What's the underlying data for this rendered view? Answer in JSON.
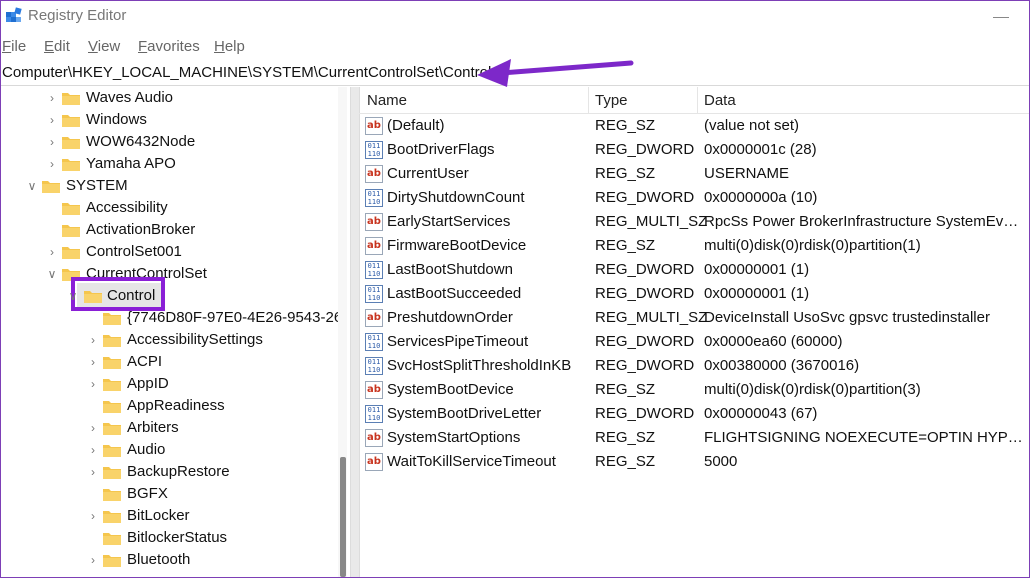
{
  "window": {
    "title": "Registry Editor"
  },
  "menu": [
    "File",
    "Edit",
    "View",
    "Favorites",
    "Help"
  ],
  "address": "Computer\\HKEY_LOCAL_MACHINE\\SYSTEM\\CurrentControlSet\\Control",
  "colors": {
    "highlight": "#8a1fd6",
    "arrow": "#7d28c9",
    "folder": "#f5c64d"
  },
  "tree": [
    {
      "label": "Waves Audio",
      "level": 2,
      "chevron": "collapsed"
    },
    {
      "label": "Windows",
      "level": 2,
      "chevron": "collapsed"
    },
    {
      "label": "WOW6432Node",
      "level": 2,
      "chevron": "collapsed"
    },
    {
      "label": "Yamaha APO",
      "level": 2,
      "chevron": "collapsed"
    },
    {
      "label": "SYSTEM",
      "level": 1,
      "chevron": "expanded"
    },
    {
      "label": "Accessibility",
      "level": 2,
      "chevron": "none"
    },
    {
      "label": "ActivationBroker",
      "level": 2,
      "chevron": "none"
    },
    {
      "label": "ControlSet001",
      "level": 2,
      "chevron": "collapsed"
    },
    {
      "label": "CurrentControlSet",
      "level": 2,
      "chevron": "expanded"
    },
    {
      "label": "Control",
      "level": 3,
      "chevron": "expanded",
      "selected": true
    },
    {
      "label": "{7746D80F-97E0-4E26-9543-26",
      "level": 4,
      "chevron": "none"
    },
    {
      "label": "AccessibilitySettings",
      "level": 4,
      "chevron": "collapsed"
    },
    {
      "label": "ACPI",
      "level": 4,
      "chevron": "collapsed"
    },
    {
      "label": "AppID",
      "level": 4,
      "chevron": "collapsed"
    },
    {
      "label": "AppReadiness",
      "level": 4,
      "chevron": "none"
    },
    {
      "label": "Arbiters",
      "level": 4,
      "chevron": "collapsed"
    },
    {
      "label": "Audio",
      "level": 4,
      "chevron": "collapsed"
    },
    {
      "label": "BackupRestore",
      "level": 4,
      "chevron": "collapsed"
    },
    {
      "label": "BGFX",
      "level": 4,
      "chevron": "none"
    },
    {
      "label": "BitLocker",
      "level": 4,
      "chevron": "collapsed"
    },
    {
      "label": "BitlockerStatus",
      "level": 4,
      "chevron": "none"
    },
    {
      "label": "Bluetooth",
      "level": 4,
      "chevron": "collapsed"
    }
  ],
  "columns": {
    "name": "Name",
    "type": "Type",
    "data": "Data"
  },
  "values": [
    {
      "icon": "string-value-icon",
      "name": "(Default)",
      "type": "REG_SZ",
      "data": "(value not set)"
    },
    {
      "icon": "binary-value-icon",
      "name": "BootDriverFlags",
      "type": "REG_DWORD",
      "data": "0x0000001c (28)"
    },
    {
      "icon": "string-value-icon",
      "name": "CurrentUser",
      "type": "REG_SZ",
      "data": "USERNAME"
    },
    {
      "icon": "binary-value-icon",
      "name": "DirtyShutdownCount",
      "type": "REG_DWORD",
      "data": "0x0000000a (10)"
    },
    {
      "icon": "string-value-icon",
      "name": "EarlyStartServices",
      "type": "REG_MULTI_SZ",
      "data": "RpcSs Power BrokerInfrastructure SystemEvents…"
    },
    {
      "icon": "string-value-icon",
      "name": "FirmwareBootDevice",
      "type": "REG_SZ",
      "data": "multi(0)disk(0)rdisk(0)partition(1)"
    },
    {
      "icon": "binary-value-icon",
      "name": "LastBootShutdown",
      "type": "REG_DWORD",
      "data": "0x00000001 (1)"
    },
    {
      "icon": "binary-value-icon",
      "name": "LastBootSucceeded",
      "type": "REG_DWORD",
      "data": "0x00000001 (1)"
    },
    {
      "icon": "string-value-icon",
      "name": "PreshutdownOrder",
      "type": "REG_MULTI_SZ",
      "data": "DeviceInstall UsoSvc gpsvc trustedinstaller"
    },
    {
      "icon": "binary-value-icon",
      "name": "ServicesPipeTimeout",
      "type": "REG_DWORD",
      "data": "0x0000ea60 (60000)"
    },
    {
      "icon": "binary-value-icon",
      "name": "SvcHostSplitThresholdInKB",
      "type": "REG_DWORD",
      "data": "0x00380000 (3670016)"
    },
    {
      "icon": "string-value-icon",
      "name": "SystemBootDevice",
      "type": "REG_SZ",
      "data": "multi(0)disk(0)rdisk(0)partition(3)"
    },
    {
      "icon": "binary-value-icon",
      "name": "SystemBootDriveLetter",
      "type": "REG_DWORD",
      "data": "0x00000043 (67)"
    },
    {
      "icon": "string-value-icon",
      "name": "SystemStartOptions",
      "type": "REG_SZ",
      "data": " FLIGHTSIGNING  NOEXECUTE=OPTIN  HYPERV…"
    },
    {
      "icon": "string-value-icon",
      "name": "WaitToKillServiceTimeout",
      "type": "REG_SZ",
      "data": "5000"
    }
  ]
}
